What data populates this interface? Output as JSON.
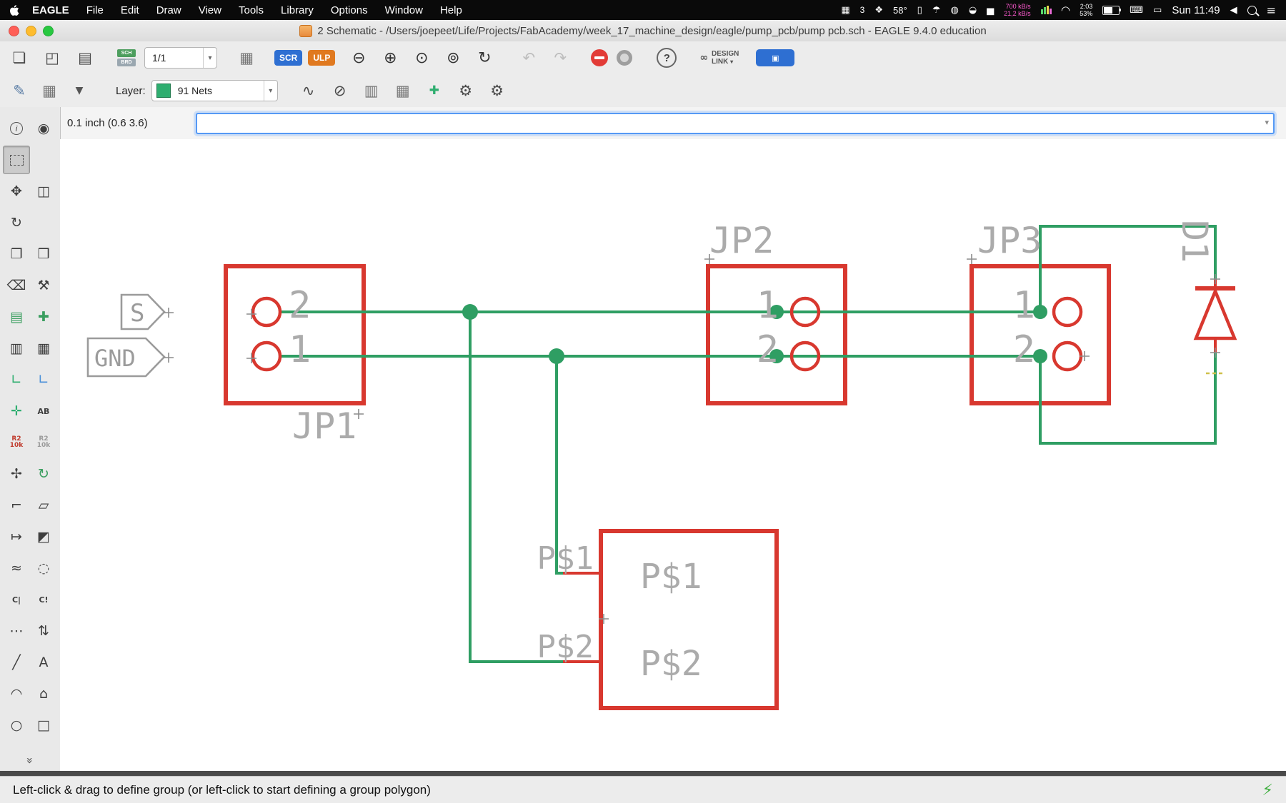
{
  "colors": {
    "net_green": "#2f9e63",
    "symbol_red": "#d8382f",
    "label_gray": "#ababab",
    "stop_red": "#e23b36",
    "scr_blue": "#2e6fd2",
    "ulp_orange": "#e0791f",
    "layer_green": "#2fae70",
    "accent_blue": "#5599f5",
    "istat_pink": "#ff5ad1"
  },
  "menubar": {
    "app_name": "EAGLE",
    "menus": [
      {
        "name": "menu-file",
        "label": "File"
      },
      {
        "name": "menu-edit",
        "label": "Edit"
      },
      {
        "name": "menu-draw",
        "label": "Draw"
      },
      {
        "name": "menu-view",
        "label": "View"
      },
      {
        "name": "menu-tools",
        "label": "Tools"
      },
      {
        "name": "menu-library",
        "label": "Library"
      },
      {
        "name": "menu-options",
        "label": "Options"
      },
      {
        "name": "menu-window",
        "label": "Window"
      },
      {
        "name": "menu-help",
        "label": "Help"
      }
    ],
    "status": {
      "count": "3",
      "temp": "58°",
      "net_up": "700 kB/s",
      "net_down": "21,2 kB/s",
      "time_left": "2:03",
      "battery_pct": "53%",
      "clock": "Sun 11:49"
    }
  },
  "window": {
    "title": "2 Schematic - /Users/joepeet/Life/Projects/FabAcademy/week_17_machine_design/eagle/pump_pcb/pump pcb.sch - EAGLE 9.4.0 education"
  },
  "toolbar": {
    "sch_label": "SCH",
    "brd_label": "BRD",
    "sheet_selector": "1/1",
    "scr": "SCR",
    "ulp": "ULP",
    "help": "?",
    "design_link_line1": "DESIGN",
    "design_link_line2": "LINK"
  },
  "toolbar2": {
    "layer_label": "Layer:",
    "layer_value": "91 Nets"
  },
  "coordbar": {
    "coordinates": "0.1 inch (0.6 3.6)",
    "command_value": ""
  },
  "icons": {
    "open": "❏",
    "save": "◰",
    "print": "▤",
    "table": "▦",
    "zoom_out": "⊖",
    "zoom_in": "⊕",
    "zoom_fit": "⊙",
    "zoom_select": "⊚",
    "zoom_redraw": "↻",
    "undo": "↶",
    "redo": "↷",
    "chevron_down": "▾",
    "link": "∞",
    "plugin_logo": "▣",
    "pen": "✎",
    "grid": "▦",
    "funnel": "▼",
    "sine": "∿",
    "no_bend": "⊘",
    "ic_a": "▥",
    "ic_b": "▦",
    "pin_add": "✚",
    "gear": "⚙",
    "window_manager": "▦",
    "diamond": "❖",
    "battery_slim": "▯",
    "umbrella": "☂",
    "globe": "◍",
    "dot_badge": "◒",
    "bars": "▅",
    "wifi": "◠",
    "keyboard": "⌨",
    "display": "▭",
    "volume": "◀",
    "menu_lines": "≡",
    "lightning": "⚡",
    "chevron_more": "»"
  },
  "palette": {
    "items": [
      {
        "name": "info-tool",
        "glyph": "i",
        "cls": "circ"
      },
      {
        "name": "eye-tool",
        "glyph": "◉"
      },
      {
        "name": "group-select-tool",
        "glyph": "",
        "cls": "marquee active"
      },
      {
        "name": "blank",
        "glyph": "",
        "cls": "blank",
        "interactable": false
      },
      {
        "name": "move-tool",
        "glyph": "✥"
      },
      {
        "name": "mirror-tool",
        "glyph": "◫"
      },
      {
        "name": "rotate-tool",
        "glyph": "↻"
      },
      {
        "name": "blank",
        "glyph": "",
        "cls": "blank",
        "interactable": false
      },
      {
        "name": "copy-tool",
        "glyph": "❐"
      },
      {
        "name": "paste-tool",
        "glyph": "❒"
      },
      {
        "name": "delete-tool",
        "glyph": "⌫"
      },
      {
        "name": "wrench-tool",
        "glyph": "⚒"
      },
      {
        "name": "replace-tool",
        "glyph": "▤",
        "color": "#3a9e5f"
      },
      {
        "name": "add-part-tool",
        "glyph": "✚",
        "color": "#3a9e5f"
      },
      {
        "name": "pinswap-tool",
        "glyph": "▥"
      },
      {
        "name": "gateswap-tool",
        "glyph": "▦"
      },
      {
        "name": "net-tool",
        "glyph": "∟",
        "color": "#2fae70"
      },
      {
        "name": "bus-tool",
        "glyph": "∟",
        "color": "#4a90d9"
      },
      {
        "name": "junction-tool",
        "glyph": "✛",
        "color": "#2fae70"
      },
      {
        "name": "label-tool",
        "glyph": "AB",
        "cls": "txt"
      },
      {
        "name": "value-tool",
        "glyph": "R2\n10k",
        "cls": "two",
        "color": "#c0392b"
      },
      {
        "name": "attribute-tool",
        "glyph": "R2\n10k",
        "cls": "two",
        "color": "#9a9a9a"
      },
      {
        "name": "smash-tool",
        "glyph": "✢"
      },
      {
        "name": "array-tool",
        "glyph": "↻",
        "color": "#3a9e5f"
      },
      {
        "name": "miter-tool",
        "glyph": "⌐"
      },
      {
        "name": "name-tool",
        "glyph": "▱"
      },
      {
        "name": "invoke-tool",
        "glyph": "↦"
      },
      {
        "name": "dimension-tool",
        "glyph": "◩"
      },
      {
        "name": "net-class-tool",
        "glyph": "≈"
      },
      {
        "name": "optimize-tool",
        "glyph": "◌"
      },
      {
        "name": "cut-tool",
        "glyph": "C|",
        "cls": "txt"
      },
      {
        "name": "errors-tool",
        "glyph": "C!",
        "cls": "txt"
      },
      {
        "name": "pattern-tool",
        "glyph": "⋯"
      },
      {
        "name": "swap-layer-tool",
        "glyph": "⇅"
      },
      {
        "name": "line-tool",
        "glyph": "╱"
      },
      {
        "name": "text-tool",
        "glyph": "A"
      },
      {
        "name": "arc-tool",
        "glyph": "◠"
      },
      {
        "name": "polygon-tool",
        "glyph": "⌂"
      },
      {
        "name": "circle-tool",
        "glyph": "○"
      },
      {
        "name": "rect-tool",
        "glyph": "□"
      }
    ]
  },
  "schematic": {
    "jp1_label": "JP1",
    "jp1_pin2": "2",
    "jp1_pin1": "1",
    "jp2_label": "JP2",
    "jp2_pin1": "1",
    "jp2_pin2": "2",
    "jp3_label": "JP3",
    "jp3_pin1": "1",
    "jp3_pin2": "2",
    "d1_label": "D1",
    "p_label1": "P$1",
    "p_label2": "P$2",
    "p_pin1": "P$1",
    "p_pin2": "P$2",
    "supply_s": "S",
    "supply_gnd": "GND"
  },
  "statusbar": {
    "message": "Left-click & drag to define group (or left-click to start defining a group polygon)"
  }
}
